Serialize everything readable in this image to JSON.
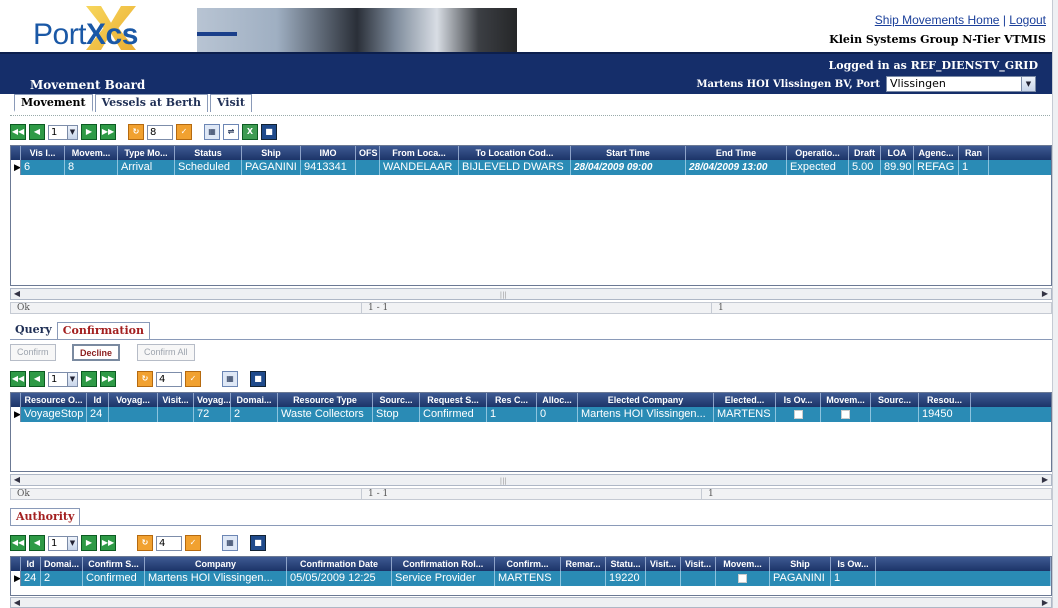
{
  "header": {
    "logo_text_plain": "Port",
    "logo_text_bold": "Xcs",
    "links": [
      "Ship Movements Home",
      "Logout"
    ],
    "link_sep": "|",
    "company": "Klein Systems Group N-Tier VTMIS",
    "logged_in": "Logged in as REF_DIENSTV_GRID",
    "port_label": "Martens HOI Vlissingen BV, Port",
    "port_value": "Vlissingen",
    "page_title": "Movement Board"
  },
  "main_tabs": [
    "Movement",
    "Vessels at Berth",
    "Visit"
  ],
  "movement_grid": {
    "page": "1",
    "page_size": "8",
    "columns": [
      "Vis I...",
      "Movem...",
      "Type Mo...",
      "Status",
      "Ship",
      "IMO",
      "OFS",
      "From Loca...",
      "To Location Cod...",
      "Start Time",
      "End Time",
      "Operatio...",
      "Draft",
      "LOA",
      "Agenc...",
      "Ran"
    ],
    "rows": [
      [
        "6",
        "8",
        "Arrival",
        "Scheduled",
        "PAGANINI",
        "9413341",
        "",
        "WANDELAAR",
        "BIJLEVELD DWARS",
        "28/04/2009 09:00",
        "28/04/2009 13:00",
        "Expected",
        "5.00",
        "89.90",
        "REFAG",
        "1"
      ]
    ],
    "status_left": "Ok",
    "status_mid": "1 - 1",
    "status_right": "1"
  },
  "sub_tabs": [
    "Query",
    "Confirmation"
  ],
  "confirm_buttons": [
    "Confirm",
    "Decline",
    "Confirm All"
  ],
  "confirmation_grid": {
    "page": "1",
    "page_size": "4",
    "columns": [
      "Resource O...",
      "Id",
      "Voyag...",
      "Visit...",
      "Voyag...",
      "Domai...",
      "Resource Type",
      "Sourc...",
      "Request S...",
      "Res C...",
      "Alloc...",
      "Elected Company",
      "Elected...",
      "Is Ov...",
      "Movem...",
      "Sourc...",
      "Resou..."
    ],
    "rows": [
      [
        "VoyageStop",
        "24",
        "",
        "",
        "72",
        "2",
        "Waste Collectors",
        "Stop",
        "Confirmed",
        "1",
        "0",
        "Martens HOI Vlissingen...",
        "MARTENS",
        "",
        "",
        "",
        "19450"
      ]
    ],
    "status_left": "Ok",
    "status_mid": "1 - 1",
    "status_right": "1"
  },
  "authority_tab": "Authority",
  "authority_grid": {
    "page": "1",
    "page_size": "4",
    "columns": [
      "Id",
      "Domai...",
      "Confirm S...",
      "Company",
      "Confirmation Date",
      "Confirmation Rol...",
      "Confirm...",
      "Remar...",
      "Statu...",
      "Visit...",
      "Visit...",
      "Movem...",
      "Ship",
      "Is Ow..."
    ],
    "rows": [
      [
        "24",
        "2",
        "Confirmed",
        "Martens HOI Vlissingen...",
        "05/05/2009 12:25",
        "Service Provider",
        "MARTENS",
        "",
        "19220",
        "",
        "",
        "",
        "PAGANINI",
        "1"
      ]
    ]
  },
  "colors": {
    "header_blue": "#152e6a",
    "grid_header": "#1c3468",
    "selected_row": "#2a8bb5",
    "active_tab_red": "#a31f1f"
  }
}
